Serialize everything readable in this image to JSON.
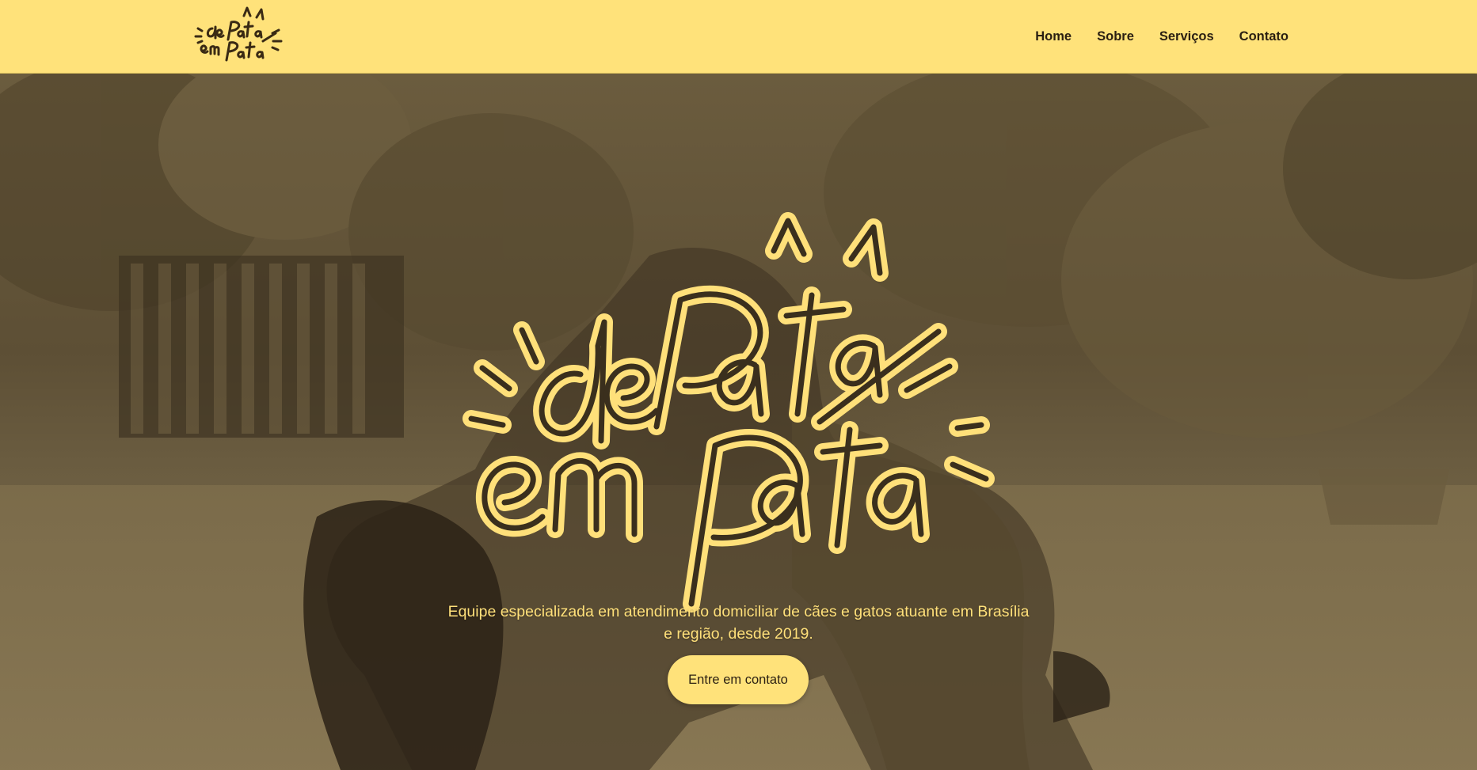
{
  "brand": {
    "logo_alt": "dePata emPata",
    "logo_icon": "cat-ears-lettering-logo"
  },
  "nav": {
    "items": [
      {
        "label": "Home"
      },
      {
        "label": "Sobre"
      },
      {
        "label": "Serviços"
      },
      {
        "label": "Contato"
      }
    ]
  },
  "hero": {
    "logo_alt": "dePata emPata",
    "tagline": "Equipe especializada em atendimento domiciliar de cães e gatos atuante em Brasília e região, desde 2019.",
    "cta_label": "Entre em contato",
    "background_description": "woman-sitting-on-grass-with-dog-sepia-photo"
  },
  "colors": {
    "accent_yellow": "#ffe27a",
    "dark_brown": "#2a1f12",
    "overlay_sepia": "#6b5c3e"
  }
}
